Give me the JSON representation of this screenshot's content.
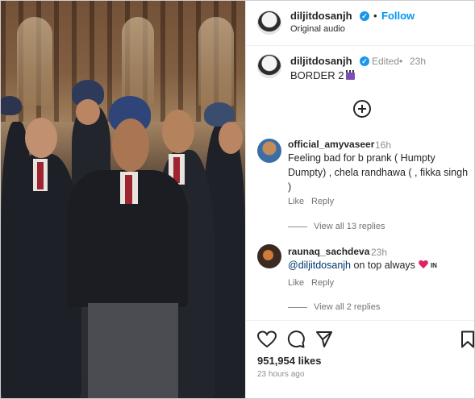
{
  "post": {
    "author": "diljitdosanjh",
    "follow_label": "Follow",
    "audio": "Original audio",
    "caption": {
      "username": "diljitdosanjh",
      "status": "Edited",
      "time": "23h",
      "text": "BORDER 2"
    },
    "likes": "951,954 likes",
    "posted_ago": "23 hours ago"
  },
  "comments": [
    {
      "username": "official_amyvaseer",
      "time": "16h",
      "text": "Feeling bad for b prank ( Humpty Dumpty) , chela randhawa ( , fikka singh )",
      "like_label": "Like",
      "reply_label": "Reply",
      "replies_label": "View all 13 replies"
    },
    {
      "username": "raunaq_sachdeva",
      "time": "23h",
      "mention": "@diljitdosanjh",
      "text": " on top always",
      "flag": "IN",
      "like_label": "Like",
      "reply_label": "Reply",
      "replies_label": "View all 2 replies"
    }
  ],
  "icons": {
    "verified": "verified-badge-icon",
    "clapper": "clapperboard-emoji",
    "add": "add-circle-icon",
    "heart": "heart-emoji",
    "like": "heart-outline-icon",
    "comment": "comment-icon",
    "share": "share-icon",
    "save": "bookmark-icon"
  },
  "colors": {
    "accent": "#0095f6",
    "verified": "#1c96e8",
    "mention": "#00376b",
    "heart": "#e0245e"
  }
}
